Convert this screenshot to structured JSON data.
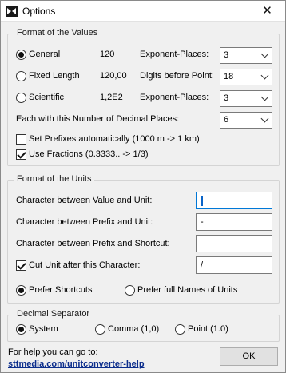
{
  "window": {
    "title": "Options",
    "close_glyph": "✕"
  },
  "values_group": {
    "title": "Format of the Values",
    "rows": [
      {
        "option": "General",
        "example": "120",
        "setting_label": "Exponent-Places:",
        "setting_value": "3",
        "checked": true
      },
      {
        "option": "Fixed Length",
        "example": "120,00",
        "setting_label": "Digits before Point:",
        "setting_value": "18",
        "checked": false
      },
      {
        "option": "Scientific",
        "example": "1,2E2",
        "setting_label": "Exponent-Places:",
        "setting_value": "3",
        "checked": false
      }
    ],
    "decimal_places_label": "Each with this Number of Decimal Places:",
    "decimal_places_value": "6",
    "set_prefixes_label": "Set Prefixes automatically (1000 m -> 1 km)",
    "set_prefixes_checked": false,
    "use_fractions_label": "Use Fractions (0.3333.. -> 1/3)",
    "use_fractions_checked": true
  },
  "units_group": {
    "title": "Format of the Units",
    "value_unit_label": "Character between Value and Unit:",
    "value_unit_value": "",
    "prefix_unit_label": "Character between Prefix and Unit:",
    "prefix_unit_value": "-",
    "prefix_shortcut_label": "Character between Prefix and Shortcut:",
    "prefix_shortcut_value": "",
    "cut_unit_label": "Cut Unit after this Character:",
    "cut_unit_value": "/",
    "cut_unit_checked": true,
    "prefer_shortcuts_label": "Prefer Shortcuts",
    "prefer_full_names_label": "Prefer full Names of Units",
    "prefer_shortcuts_checked": true
  },
  "decimal_group": {
    "title": "Decimal Separator",
    "options": [
      {
        "label": "System",
        "checked": true
      },
      {
        "label": "Comma (1,0)",
        "checked": false
      },
      {
        "label": "Point (1.0)",
        "checked": false
      }
    ]
  },
  "footer": {
    "help_text": "For help you can go to:",
    "help_link": "sttmedia.com/unitconverter-help",
    "ok_label": "OK"
  },
  "icons": {
    "app": "converter-arrows-icon",
    "close": "close-icon",
    "dropdown": "chevron-down-icon"
  }
}
